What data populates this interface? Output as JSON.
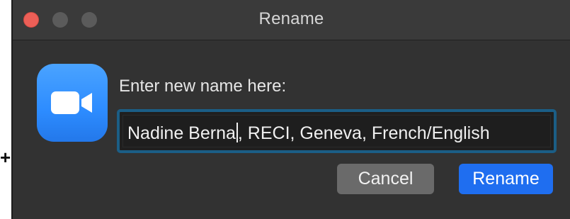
{
  "dialog": {
    "title": "Rename",
    "prompt": "Enter new name here:",
    "field_value_before_caret": "Nadine Berna",
    "field_value_after_caret": ", RECI, Geneva, French/English",
    "cancel_label": "Cancel",
    "rename_label": "Rename"
  },
  "cursor_glyph": "+",
  "colors": {
    "close_button": "#ec5f57",
    "app_icon": "#2d8cff",
    "focus_ring": "#1b5e86",
    "primary_button": "#1f6ef0"
  },
  "icons": {
    "app_icon": "video-camera-icon"
  }
}
